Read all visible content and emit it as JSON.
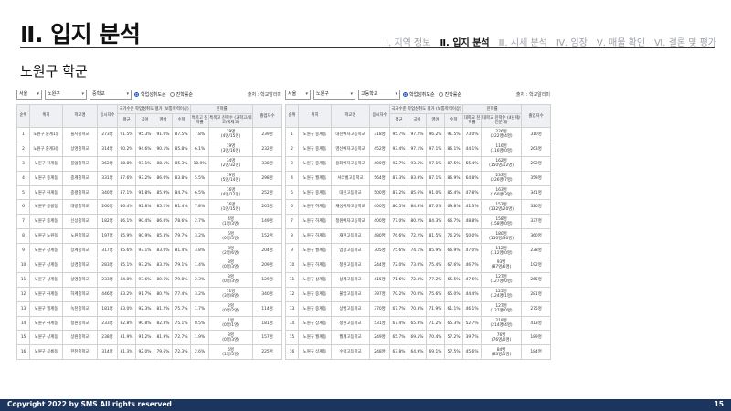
{
  "header": {
    "title": "Ⅱ. 입지 분석",
    "nav": [
      "Ⅰ. 지역 정보",
      "Ⅱ. 입지 분석",
      "Ⅲ. 시세 분석",
      "Ⅳ. 임장",
      "Ⅴ. 매물 확인",
      "Ⅵ. 결론 및 평가"
    ]
  },
  "subtitle": "노원구 학군",
  "left_panel": {
    "filters": {
      "city": "서울",
      "district": "노원구",
      "level": "중학교",
      "radio_on": "학업성취도순",
      "radio_off": "진학률순",
      "source": "출처 : 학교알리미"
    },
    "headers": {
      "rank": "순위",
      "location": "위치",
      "school": "학교명",
      "students": "응시자수",
      "group": "국가수준 학업성취도 평가 (보통학력이상)",
      "group2": "진학률",
      "avg": "평균",
      "kor": "국어",
      "eng": "영어",
      "math": "수학",
      "special": "특목고 진학률",
      "special2": "특목고 진학수 (과학고/외고/국제고)",
      "grad": "졸업자수"
    },
    "rows": [
      [
        "1",
        "노원구 중계1동",
        "을지중학교",
        "273명",
        "91.5%",
        "95.3%",
        "91.0%",
        "87.5%",
        "7.8%",
        "19명",
        "(4명/15명)",
        "239명"
      ],
      [
        "2",
        "노원구 중계3동",
        "상명중학교",
        "314명",
        "90.2%",
        "94.6%",
        "90.1%",
        "85.8%",
        "6.1%",
        "19명",
        "(3명/16명)",
        "232명"
      ],
      [
        "3",
        "노원구 하계동",
        "불암중학교",
        "362명",
        "88.8%",
        "93.1%",
        "88.1%",
        "85.3%",
        "10.0%",
        "34명",
        "(2명/32명)",
        "338명"
      ],
      [
        "4",
        "노원구 중계동",
        "중계중학교",
        "331명",
        "87.6%",
        "93.2%",
        "86.0%",
        "83.8%",
        "5.5%",
        "19명",
        "(5명/14명)",
        "298명"
      ],
      [
        "5",
        "노원구 하계동",
        "중평중학교",
        "340명",
        "87.1%",
        "91.8%",
        "85.9%",
        "84.7%",
        "6.5%",
        "16명",
        "(4명/12명)",
        "252명"
      ],
      [
        "6",
        "노원구 공릉동",
        "태랑중학교",
        "260명",
        "86.4%",
        "92.8%",
        "85.2%",
        "81.4%",
        "7.8%",
        "16명",
        "(1명/15명)",
        "205명"
      ],
      [
        "7",
        "노원구 중계동",
        "신상중학교",
        "182명",
        "86.1%",
        "90.4%",
        "86.0%",
        "78.6%",
        "2.7%",
        "4명",
        "(1명/3명)",
        "149명"
      ],
      [
        "8",
        "노원구 노원동",
        "노원중학교",
        "197명",
        "85.9%",
        "90.9%",
        "85.3%",
        "79.7%",
        "3.2%",
        "5명",
        "(0명/5명)",
        "152명"
      ],
      [
        "9",
        "노원구 상계동",
        "상계중학교",
        "317명",
        "85.6%",
        "93.1%",
        "83.0%",
        "81.4%",
        "3.8%",
        "8명",
        "(2명/6명)",
        "204명"
      ],
      [
        "10",
        "노원구 상계동",
        "상경중학교",
        "283명",
        "85.1%",
        "93.2%",
        "83.2%",
        "79.1%",
        "1.4%",
        "3명",
        "(0명/3명)",
        "209명"
      ],
      [
        "11",
        "노원구 상계동",
        "상명중학교",
        "233명",
        "84.8%",
        "93.6%",
        "80.6%",
        "79.8%",
        "2.3%",
        "3명",
        "(0명/3명)",
        "129명"
      ],
      [
        "12",
        "노원구 하계동",
        "하계중학교",
        "446명",
        "83.2%",
        "91.7%",
        "80.7%",
        "77.4%",
        "3.2%",
        "11명",
        "(3명/8명)",
        "340명"
      ],
      [
        "13",
        "노원구 월계동",
        "녹천중학교",
        "181명",
        "83.0%",
        "92.3%",
        "81.2%",
        "75.7%",
        "1.7%",
        "2명",
        "(0명/2명)",
        "114명"
      ],
      [
        "14",
        "노원구 하계동",
        "청원중학교",
        "233명",
        "82.8%",
        "90.8%",
        "82.8%",
        "75.1%",
        "0.5%",
        "1명",
        "(0명/1명)",
        "181명"
      ],
      [
        "15",
        "노원구 상계동",
        "상원중학교",
        "238명",
        "81.9%",
        "91.2%",
        "81.9%",
        "72.7%",
        "1.9%",
        "3명",
        "(0명/3명)",
        "157명"
      ],
      [
        "16",
        "노원구 공릉동",
        "한천중학교",
        "314명",
        "81.3%",
        "92.0%",
        "79.6%",
        "72.3%",
        "2.6%",
        "6명",
        "(1명/5명)",
        "225명"
      ]
    ]
  },
  "right_panel": {
    "filters": {
      "city": "서울",
      "district": "노원구",
      "level": "고등학교",
      "radio_on": "학업성취도순",
      "radio_off": "진학률순",
      "source": "출처 : 학교알리미"
    },
    "headers": {
      "rank": "순위",
      "location": "위치",
      "school": "학교명",
      "students": "응시자수",
      "group": "국가수준 학업성취도 평가 (보통학력이상)",
      "group2": "진학률",
      "avg": "평균",
      "kor": "국어",
      "eng": "영어",
      "math": "수학",
      "univ": "대학교 진학률",
      "univ2": "대학교 진학수 (4년제/전문대)",
      "grad": "졸업자수"
    },
    "rows": [
      [
        "1",
        "노원구 중계동",
        "대진여자고등학교",
        "318명",
        "95.7%",
        "97.2%",
        "96.2%",
        "91.5%",
        "73.0%",
        "226명",
        "(222명/4명)",
        "310명"
      ],
      [
        "2",
        "노원구 중계동",
        "영신여자고등학교",
        "452명",
        "93.4%",
        "97.1%",
        "97.1%",
        "86.1%",
        "44.1%",
        "116명",
        "(116명/0명)",
        "263명"
      ],
      [
        "3",
        "노원구 중계동",
        "용화여자고등학교",
        "400명",
        "92.7%",
        "93.5%",
        "97.1%",
        "87.5%",
        "55.4%",
        "162명",
        "(150명/12명)",
        "292명"
      ],
      [
        "4",
        "노원구 월계동",
        "서라벌고등학교",
        "564명",
        "87.3%",
        "83.8%",
        "87.1%",
        "86.9%",
        "64.8%",
        "233명",
        "(226명/7명)",
        "359명"
      ],
      [
        "5",
        "노원구 중계동",
        "대진고등학교",
        "500명",
        "87.2%",
        "85.6%",
        "91.0%",
        "85.4%",
        "47.8%",
        "163명",
        "(160명/3명)",
        "341명"
      ],
      [
        "6",
        "노원구 하계동",
        "재성여자고등학교",
        "400명",
        "80.5%",
        "84.8%",
        "87.0%",
        "69.8%",
        "41.3%",
        "152명",
        "(132명/20명)",
        "320명"
      ],
      [
        "7",
        "노원구 하계동",
        "청원여자고등학교",
        "400명",
        "77.0%",
        "80.2%",
        "84.3%",
        "66.7%",
        "48.8%",
        "158명",
        "(158명/0명)",
        "337명"
      ],
      [
        "8",
        "노원구 하계동",
        "재현고등학교",
        "480명",
        "76.6%",
        "72.2%",
        "81.5%",
        "76.2%",
        "50.0%",
        "180명",
        "(150명/30명)",
        "360명"
      ],
      [
        "9",
        "노원구 월계동",
        "염광고등학교",
        "305명",
        "75.6%",
        "74.1%",
        "85.9%",
        "66.9%",
        "47.0%",
        "112명",
        "(112명/0명)",
        "238명"
      ],
      [
        "10",
        "노원구 하계동",
        "청원고등학교",
        "244명",
        "72.0%",
        "73.0%",
        "75.4%",
        "67.6%",
        "46.7%",
        "93명",
        "(87명/6명)",
        "192명"
      ],
      [
        "11",
        "노원구 상계동",
        "상계고등학교",
        "415명",
        "71.6%",
        "72.3%",
        "77.2%",
        "65.5%",
        "47.6%",
        "127명",
        "(127명/0명)",
        "265명"
      ],
      [
        "12",
        "노원구 중계동",
        "불암고등학교",
        "397명",
        "70.2%",
        "70.0%",
        "75.6%",
        "65.0%",
        "44.4%",
        "125명",
        "(124명/1명)",
        "281명"
      ],
      [
        "13",
        "노원구 중계동",
        "상명고등학교",
        "370명",
        "67.7%",
        "70.3%",
        "71.9%",
        "61.1%",
        "46.1%",
        "127명",
        "(127명/0명)",
        "275명"
      ],
      [
        "14",
        "노원구 상계동",
        "청원고등학교",
        "531명",
        "67.4%",
        "65.8%",
        "71.2%",
        "65.3%",
        "52.7%",
        "218명",
        "(214명/4명)",
        "413명"
      ],
      [
        "15",
        "노원구 월계동",
        "월계고등학교",
        "249명",
        "65.7%",
        "69.5%",
        "70.4%",
        "57.2%",
        "39.7%",
        "76명",
        "(76명/0명)",
        "189명"
      ],
      [
        "16",
        "노원구 상계동",
        "수락고등학교",
        "248명",
        "63.8%",
        "64.9%",
        "69.1%",
        "57.5%",
        "45.6%",
        "84명",
        "(83명/1명)",
        "184명"
      ]
    ]
  },
  "footer": {
    "copyright": "Copyright 2022 by SMS All rights reserved",
    "page": "15"
  }
}
